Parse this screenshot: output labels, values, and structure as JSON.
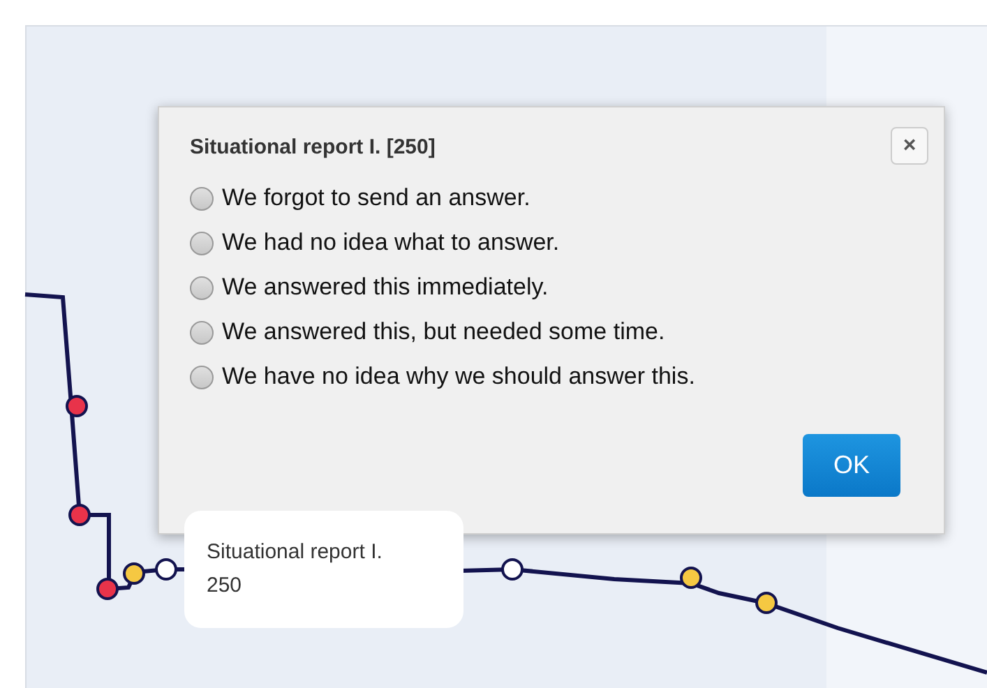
{
  "dialog": {
    "title": "Situational report I. [250]",
    "close_label": "×",
    "options": [
      {
        "label": "We forgot to send an answer.",
        "selected": false
      },
      {
        "label": "We had no idea what to answer.",
        "selected": false
      },
      {
        "label": "We answered this immediately.",
        "selected": false
      },
      {
        "label": "We answered this, but needed some time.",
        "selected": false
      },
      {
        "label": "We have no idea why we should answer this.",
        "selected": false
      }
    ],
    "ok_button": "OK"
  },
  "tooltip": {
    "title": "Situational report I.",
    "value": "250"
  }
}
